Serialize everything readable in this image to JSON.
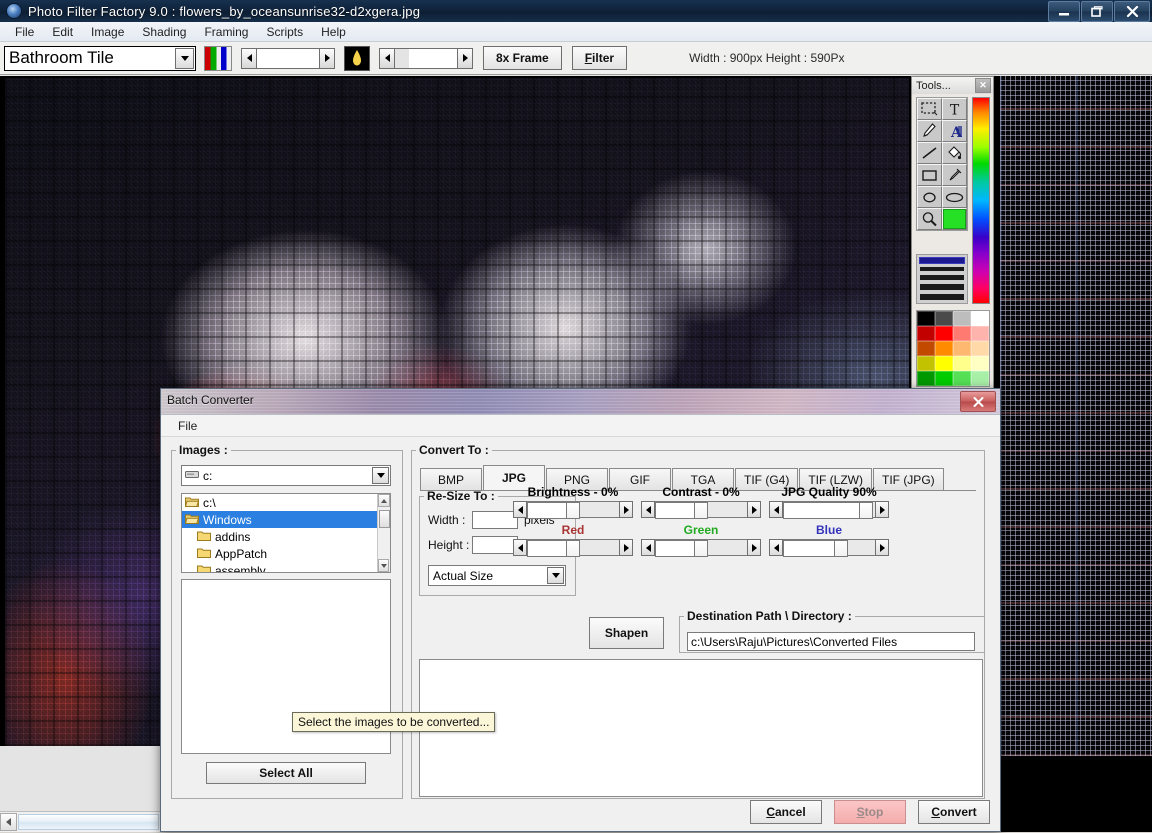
{
  "window": {
    "title": "Photo Filter Factory 9.0 : flowers_by_oceansunrise32-d2xgera.jpg",
    "icon": "app-globe-icon",
    "controls": {
      "minimize": "–",
      "restore": "❐",
      "close": "✕"
    }
  },
  "menubar": {
    "items": [
      "File",
      "Edit",
      "Image",
      "Shading",
      "Framing",
      "Scripts",
      "Help"
    ]
  },
  "toolbar": {
    "filter_select_value": "Bathroom Tile",
    "frame_button": "8x Frame",
    "filter_button": "Filter",
    "dimensions_text": "Width : 900px   Height : 590Px",
    "rgb_swatch_name": "rgb-color-swatch",
    "lamp_swatch_name": "lamp-preview-swatch",
    "spin1_value": "",
    "spin2_value": ""
  },
  "tools_palette": {
    "title": "Tools...",
    "close_label": "✕",
    "tools": [
      {
        "name": "select-rectangle-tool"
      },
      {
        "name": "text-tool"
      },
      {
        "name": "pencil-tool"
      },
      {
        "name": "font-style-tool"
      },
      {
        "name": "line-tool"
      },
      {
        "name": "paint-bucket-tool"
      },
      {
        "name": "rectangle-tool"
      },
      {
        "name": "eyedropper-tool"
      },
      {
        "name": "circle-outline-tool"
      },
      {
        "name": "ellipse-tool"
      },
      {
        "name": "zoom-tool"
      },
      {
        "name": "current-color-swatch"
      }
    ],
    "current_color": "#26e026",
    "line_widths": [
      3,
      4,
      5,
      6
    ],
    "selected_line_width_index": 0,
    "palette_colors": [
      "#000000",
      "#4a4a4a",
      "#bdbdbd",
      "#ffffff",
      "#c20000",
      "#ff0000",
      "#ff7b72",
      "#ffb3ad",
      "#c24a00",
      "#ff8c00",
      "#ffb870",
      "#ffd9a8",
      "#c2c200",
      "#ffff00",
      "#ffff8c",
      "#ffffc4",
      "#009900",
      "#00cc00",
      "#55e055",
      "#a8f0a8"
    ]
  },
  "dialog": {
    "title": "Batch Converter",
    "close_label": "✕",
    "menu": [
      "File"
    ],
    "images_group": {
      "legend": "Images :",
      "drive_value": "c:",
      "folders": [
        {
          "label": "c:\\",
          "selected": false,
          "indent": false
        },
        {
          "label": "Windows",
          "selected": true,
          "indent": false
        },
        {
          "label": "addins",
          "selected": false,
          "indent": true
        },
        {
          "label": "AppPatch",
          "selected": false,
          "indent": true
        },
        {
          "label": "assembly",
          "selected": false,
          "indent": true
        }
      ],
      "select_all_label": "Select All",
      "file_list_items": []
    },
    "convert_group": {
      "legend": "Convert To :",
      "tabs": [
        {
          "label": "BMP",
          "active": false
        },
        {
          "label": "JPG",
          "active": true
        },
        {
          "label": "PNG",
          "active": false
        },
        {
          "label": "GIF",
          "active": false
        },
        {
          "label": "TGA",
          "active": false
        },
        {
          "label": "TIF (G4)",
          "active": false
        },
        {
          "label": "TIF (LZW)",
          "active": false
        },
        {
          "label": "TIF (JPG)",
          "active": false
        }
      ],
      "resize": {
        "legend": "Re-Size To :",
        "width_label": "Width :",
        "width_value": "",
        "height_label": "Height :",
        "height_value": "",
        "unit": "pixels",
        "size_mode": "Actual Size"
      },
      "sliders": [
        {
          "name": "brightness",
          "caption": "Brightness - 0%",
          "percent": 50,
          "color": "#000000"
        },
        {
          "name": "contrast",
          "caption": "Contrast - 0%",
          "percent": 50,
          "color": "#000000"
        },
        {
          "name": "jpg-quality",
          "caption": "JPG Quality 90%",
          "percent": 90,
          "color": "#000000"
        },
        {
          "name": "red",
          "caption": "Red",
          "percent": 50,
          "color": "#aa3333"
        },
        {
          "name": "green",
          "caption": "Green",
          "percent": 50,
          "color": "#22aa22"
        },
        {
          "name": "blue",
          "caption": "Blue",
          "percent": 63,
          "color": "#3333bb"
        }
      ],
      "shapen_label": "Shapen",
      "destination": {
        "legend": "Destination Path \\ Directory :",
        "value": "c:\\Users\\Raju\\Pictures\\Converted Files"
      },
      "log_text": ""
    },
    "footer": {
      "cancel": "Cancel",
      "stop": "Stop",
      "convert": "Convert"
    }
  },
  "tooltip": {
    "text": "Select the images to be converted..."
  }
}
